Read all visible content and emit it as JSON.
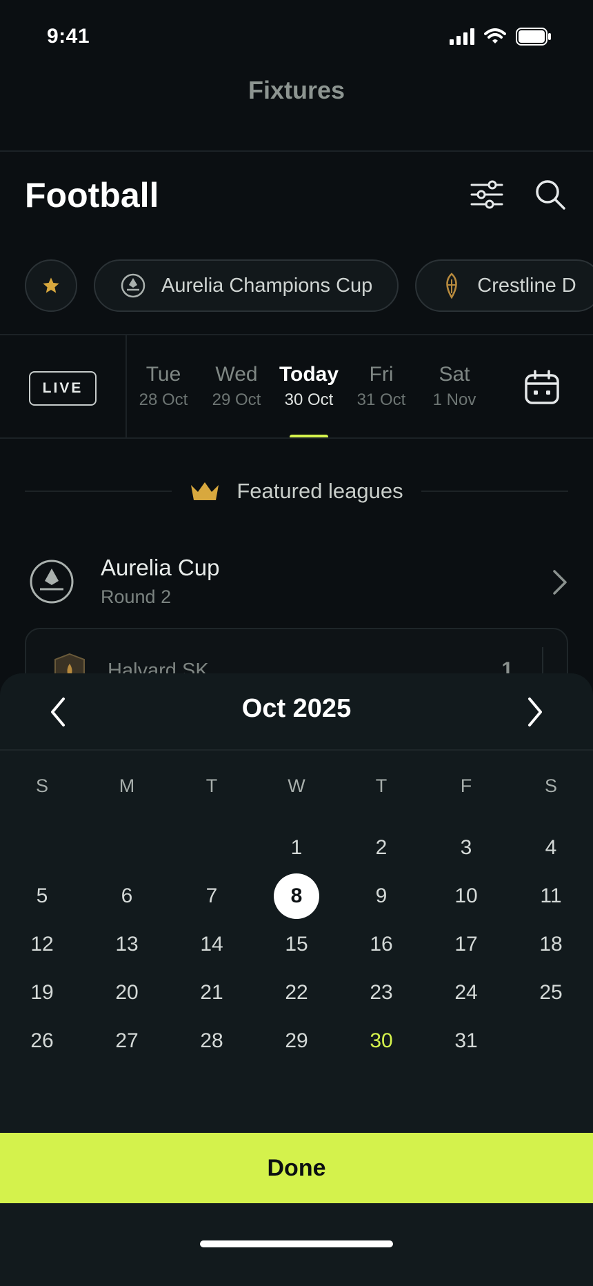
{
  "status_bar": {
    "time": "9:41"
  },
  "nav": {
    "title": "Fixtures"
  },
  "header": {
    "title": "Football"
  },
  "chips": [
    {
      "label": "Aurelia Champions Cup",
      "icon": "league-shield-icon"
    },
    {
      "label": "Crestline D",
      "icon": "league-leaf-icon"
    }
  ],
  "date_bar": {
    "live_label": "LIVE",
    "days": [
      {
        "name": "Tue",
        "date": "28 Oct"
      },
      {
        "name": "Wed",
        "date": "29 Oct"
      },
      {
        "name": "Today",
        "date": "30 Oct"
      },
      {
        "name": "Fri",
        "date": "31 Oct"
      },
      {
        "name": "Sat",
        "date": "1 Nov"
      }
    ]
  },
  "featured": {
    "label": "Featured leagues"
  },
  "league": {
    "name": "Aurelia Cup",
    "round": "Round 2"
  },
  "match": {
    "team": "Halvard SK",
    "score": "1"
  },
  "calendar": {
    "month_label": "Oct 2025",
    "weekdays": [
      "S",
      "M",
      "T",
      "W",
      "T",
      "F",
      "S"
    ],
    "days": [
      "1",
      "2",
      "3",
      "4",
      "5",
      "6",
      "7",
      "8",
      "9",
      "10",
      "11",
      "12",
      "13",
      "14",
      "15",
      "16",
      "17",
      "18",
      "19",
      "20",
      "21",
      "22",
      "23",
      "24",
      "25",
      "26",
      "27",
      "28",
      "29",
      "30",
      "31"
    ],
    "first_weekday": 3,
    "selected_day": 8,
    "today_day": 30,
    "accent": "#d4f24c"
  },
  "done_label": "Done"
}
